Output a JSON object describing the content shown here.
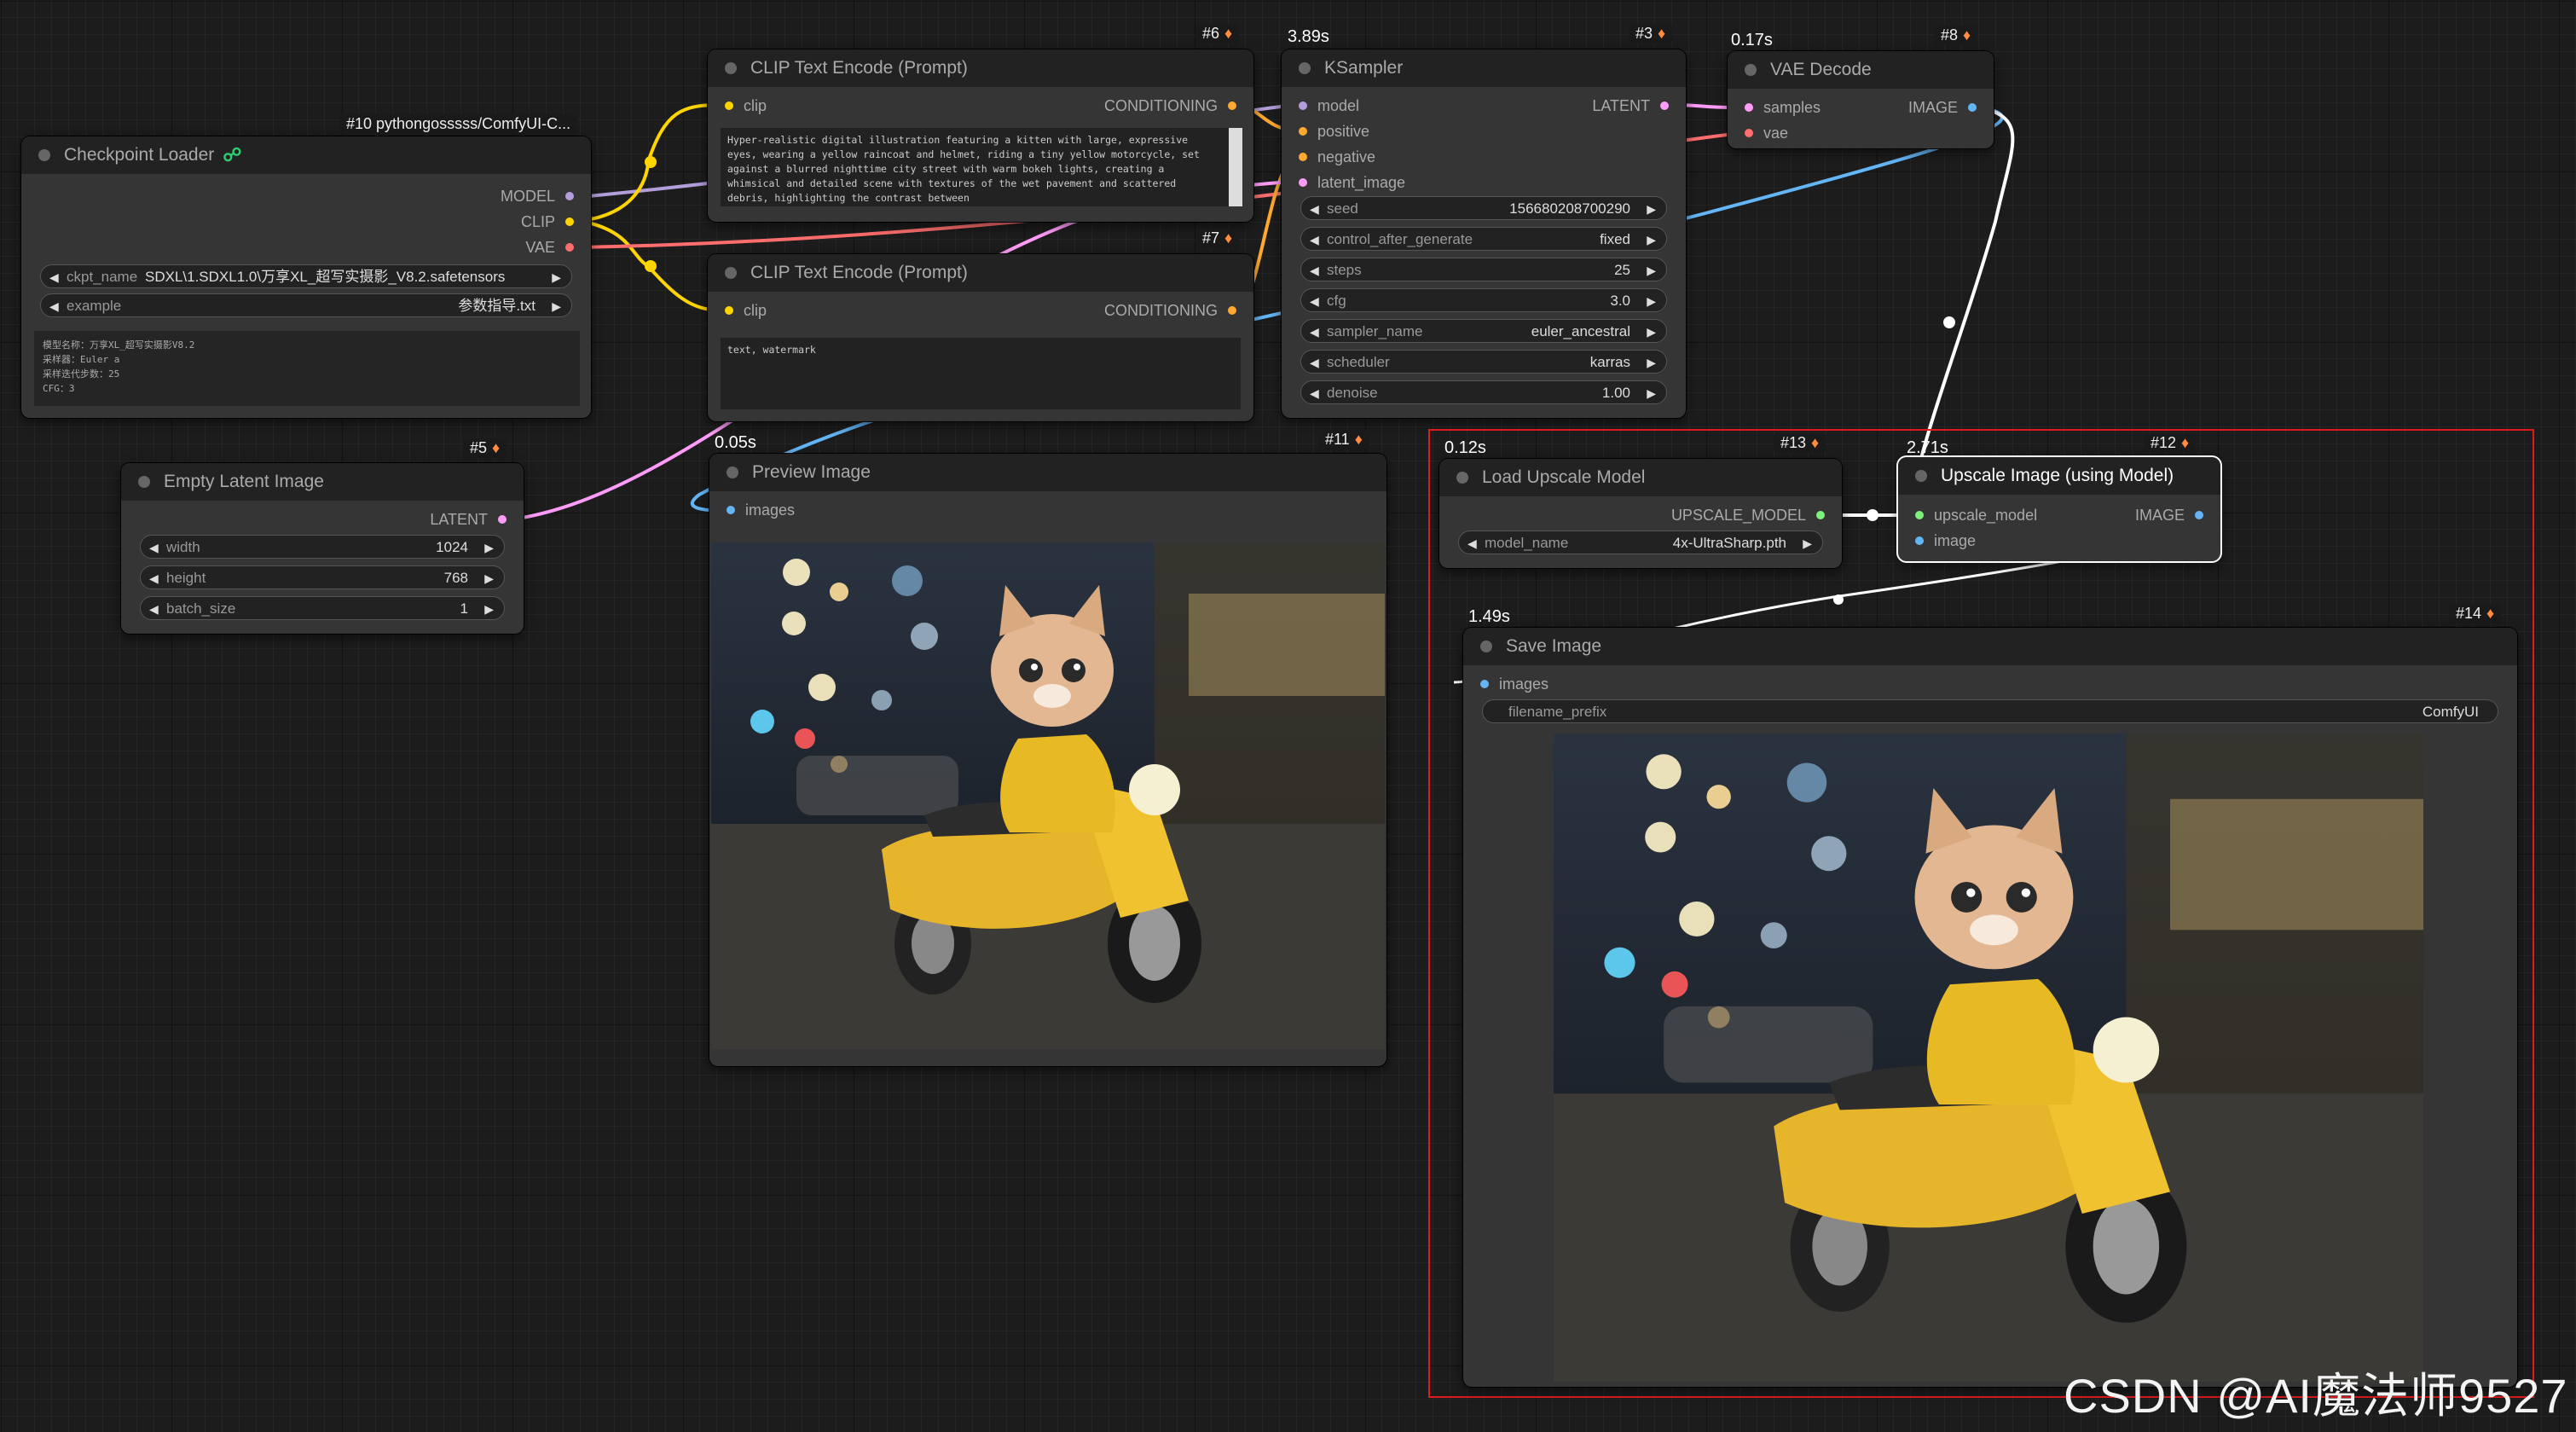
{
  "colors": {
    "model": "#b39ddb",
    "clip": "#ffd500",
    "vae": "#ff6e6e",
    "conditioning": "#ffa931",
    "latent": "#ff9cf9",
    "image": "#64b5f6",
    "upscale_model": "#7cf27c",
    "selection": "#e01a1a"
  },
  "nodes": {
    "checkpoint": {
      "title": "Checkpoint Loader",
      "badge": "#10 pythongosssss/ComfyUI-C...",
      "outputs": [
        "MODEL",
        "CLIP",
        "VAE"
      ],
      "ckpt_name_label": "ckpt_name",
      "ckpt_name_value": "SDXL\\1.SDXL1.0\\万享XL_超写实摄影_V8.2.safetensors",
      "example_label": "example",
      "example_value": "参数指导.txt",
      "note": "模型名称：万享XL_超写实摄影V8.2\n采样器：Euler a\n采样迭代步数：25\nCFG：3"
    },
    "clip_pos": {
      "badge": "#6",
      "title": "CLIP Text Encode (Prompt)",
      "input": "clip",
      "output": "CONDITIONING",
      "text": "Hyper-realistic digital illustration featuring a kitten with large, expressive eyes, wearing a yellow raincoat and helmet, riding a tiny yellow motorcycle, set against a blurred nighttime city street with warm bokeh lights, creating a whimsical and detailed scene with textures of the wet pavement and scattered debris, highlighting the contrast between"
    },
    "clip_neg": {
      "badge": "#7",
      "title": "CLIP Text Encode (Prompt)",
      "input": "clip",
      "output": "CONDITIONING",
      "text": "text, watermark"
    },
    "ksampler": {
      "badge": "#3",
      "timing": "3.89s",
      "title": "KSampler",
      "inputs": [
        "model",
        "positive",
        "negative",
        "latent_image"
      ],
      "output": "LATENT",
      "widgets": [
        {
          "name": "seed",
          "value": "156680208700290"
        },
        {
          "name": "control_after_generate",
          "value": "fixed"
        },
        {
          "name": "steps",
          "value": "25"
        },
        {
          "name": "cfg",
          "value": "3.0"
        },
        {
          "name": "sampler_name",
          "value": "euler_ancestral"
        },
        {
          "name": "scheduler",
          "value": "karras"
        },
        {
          "name": "denoise",
          "value": "1.00"
        }
      ]
    },
    "vae_decode": {
      "badge": "#8",
      "timing": "0.17s",
      "title": "VAE Decode",
      "inputs": [
        "samples",
        "vae"
      ],
      "output": "IMAGE"
    },
    "empty_latent": {
      "badge": "#5",
      "title": "Empty Latent Image",
      "output": "LATENT",
      "widgets": [
        {
          "name": "width",
          "value": "1024"
        },
        {
          "name": "height",
          "value": "768"
        },
        {
          "name": "batch_size",
          "value": "1"
        }
      ]
    },
    "preview": {
      "badge": "#11",
      "timing": "0.05s",
      "title": "Preview Image",
      "input": "images"
    },
    "load_upscale": {
      "badge": "#13",
      "timing": "0.12s",
      "title": "Load Upscale Model",
      "output": "UPSCALE_MODEL",
      "widget_name": "model_name",
      "widget_value": "4x-UltraSharp.pth"
    },
    "upscale_image": {
      "badge": "#12",
      "timing": "2.71s",
      "title": "Upscale Image (using Model)",
      "inputs": [
        "upscale_model",
        "image"
      ],
      "output": "IMAGE"
    },
    "save_image": {
      "badge": "#14",
      "timing": "1.49s",
      "title": "Save Image",
      "input": "images",
      "widget_name": "filename_prefix",
      "widget_value": "ComfyUI"
    }
  },
  "watermark": "CSDN @AI魔法师9527"
}
